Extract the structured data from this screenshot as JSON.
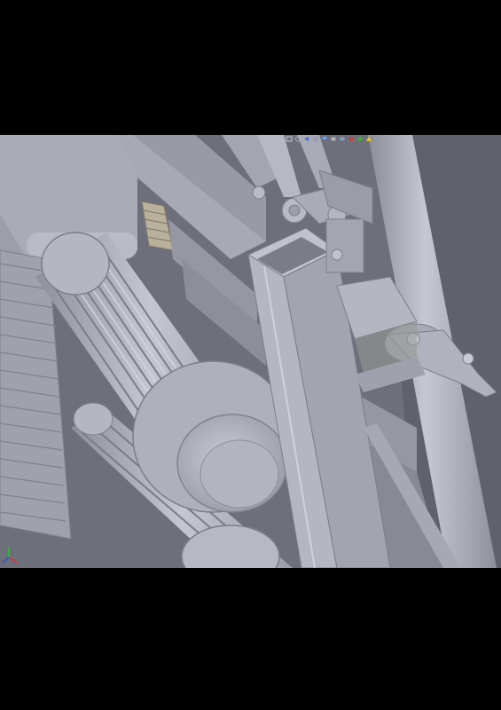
{
  "viewport": {
    "background": "#6d6f7b",
    "model_color": "#b8bac6",
    "toolbar": {
      "buttons": [
        {
          "icon": "zoom-to-fit-icon",
          "color": "#c9c9c9"
        },
        {
          "icon": "zoom-area-icon",
          "color": "#b0b0b0"
        },
        {
          "icon": "previous-view-icon",
          "color": "#4a6ad0"
        },
        {
          "icon": "section-view-icon",
          "color": "#9aa0b0"
        },
        {
          "icon": "view-orientation-icon",
          "color": "#6aa0ff"
        },
        {
          "icon": "display-style-icon",
          "color": "#b0b0b0"
        },
        {
          "icon": "hide-show-icon",
          "color": "#8aa0c0"
        },
        {
          "icon": "edit-appearance-icon",
          "color": "#d04040"
        },
        {
          "icon": "apply-scene-icon",
          "color": "#40b040"
        },
        {
          "icon": "view-settings-icon",
          "color": "#e0c040"
        }
      ]
    },
    "triad": {
      "x_color": "#e03030",
      "y_color": "#30c030",
      "z_color": "#3050e0"
    }
  }
}
